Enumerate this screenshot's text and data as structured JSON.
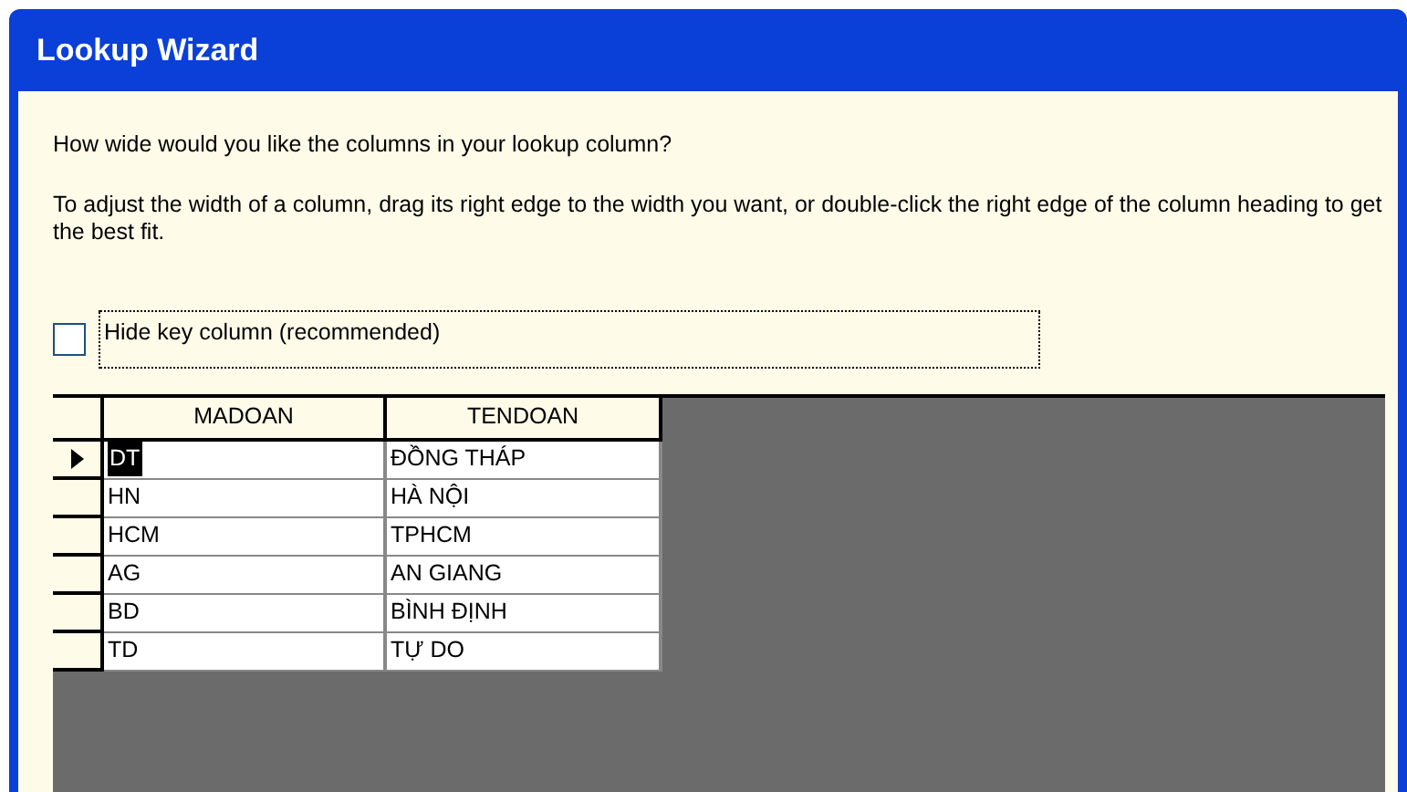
{
  "window": {
    "title": "Lookup Wizard"
  },
  "question": "How wide would you like the columns in your lookup column?",
  "instructions": "To adjust the width of a column, drag its right edge to the width you want, or double-click the right edge of the column heading to get the best fit.",
  "hide_key_column": {
    "label": "Hide key column (recommended)",
    "checked": false,
    "focused": true
  },
  "table": {
    "columns": [
      "MADOAN",
      "TENDOAN"
    ],
    "rows": [
      {
        "cells": [
          "DT",
          "ĐỒNG THÁP"
        ],
        "selected": true
      },
      {
        "cells": [
          "HN",
          "HÀ NỘI"
        ],
        "selected": false
      },
      {
        "cells": [
          "HCM",
          "TPHCM"
        ],
        "selected": false
      },
      {
        "cells": [
          "AG",
          "AN GIANG"
        ],
        "selected": false
      },
      {
        "cells": [
          "BD",
          "BÌNH ĐỊNH"
        ],
        "selected": false
      },
      {
        "cells": [
          "TD",
          "TỰ DO"
        ],
        "selected": false
      }
    ]
  }
}
